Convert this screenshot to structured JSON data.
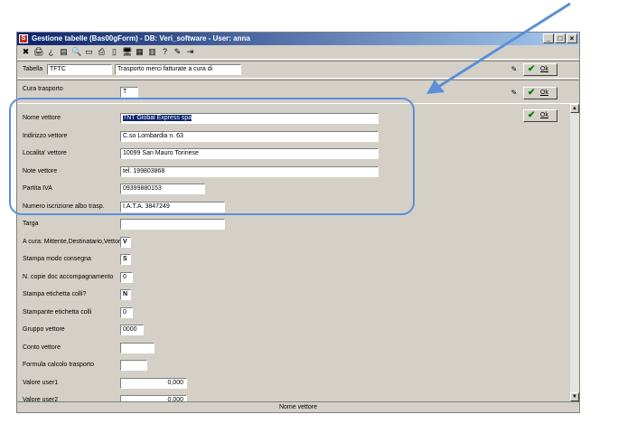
{
  "window": {
    "title": "Gestione tabelle  (Bas00gForm) - DB: Veri_software - User: anna",
    "app_icon": "S"
  },
  "window_buttons": {
    "minimize": "_",
    "maximize": "□",
    "close": "×"
  },
  "toolbar": [
    "close-x-icon",
    "print-icon",
    "help-icon",
    "list-icon",
    "search-icon",
    "rectangle-icon",
    "printer-icon",
    "document-icon",
    "monitor-icon",
    "calendar-icon",
    "table-icon",
    "question-icon",
    "pin-icon",
    "exit-icon"
  ],
  "toolbar_glyphs": [
    "✖",
    "🖨",
    "¿",
    "▤",
    "🔍",
    "▭",
    "⎙",
    "▯",
    "🖥",
    "▦",
    "▥",
    "?",
    "✎",
    "⇥"
  ],
  "tabella": {
    "label": "Tabella",
    "code": "TFTC",
    "description": "Trasporto merci fatturate a cura di"
  },
  "cura_trasporto": {
    "label": "Cura trasporto",
    "value": "T"
  },
  "ok_label": "Ok",
  "fields": [
    {
      "label": "Nome vettore",
      "value": "TNT Global Express spa"
    },
    {
      "label": "Indirizzo vettore",
      "value": "C.so Lombardia n. 63"
    },
    {
      "label": "Localita' vettore",
      "value": "10099 San Mauro Torinese"
    },
    {
      "label": "Note vettore",
      "value": "tel. 199803868"
    },
    {
      "label": "Partita IVA",
      "value": "09399880153"
    },
    {
      "label": "Numero iscrizione albo trasp.",
      "value": "I.A.T.A. 3847249"
    },
    {
      "label": "Targa",
      "value": ""
    },
    {
      "label": "A cura: Mittente,Destinatario,Vettore",
      "value": "V"
    },
    {
      "label": "Stampa modo consegna",
      "value": "S"
    },
    {
      "label": "N. copie doc accompagnamento",
      "value": "0"
    },
    {
      "label": "Stampa etichetta colli?",
      "value": "N"
    },
    {
      "label": "Stampante etichetta colli",
      "value": "0"
    },
    {
      "label": "Gruppo vettore",
      "value": "0000"
    },
    {
      "label": "Conto vettore",
      "value": ""
    },
    {
      "label": "Formula calcolo trasporto",
      "value": ""
    },
    {
      "label": "Valore user1",
      "value": "0,000"
    },
    {
      "label": "Valore user2",
      "value": "0,000"
    }
  ],
  "status": "Nome vettore",
  "colors": {
    "titlebar": "#0a246a",
    "face": "#d4d0c8",
    "highlight": "#5b8fd8",
    "ok_check": "#008000"
  }
}
